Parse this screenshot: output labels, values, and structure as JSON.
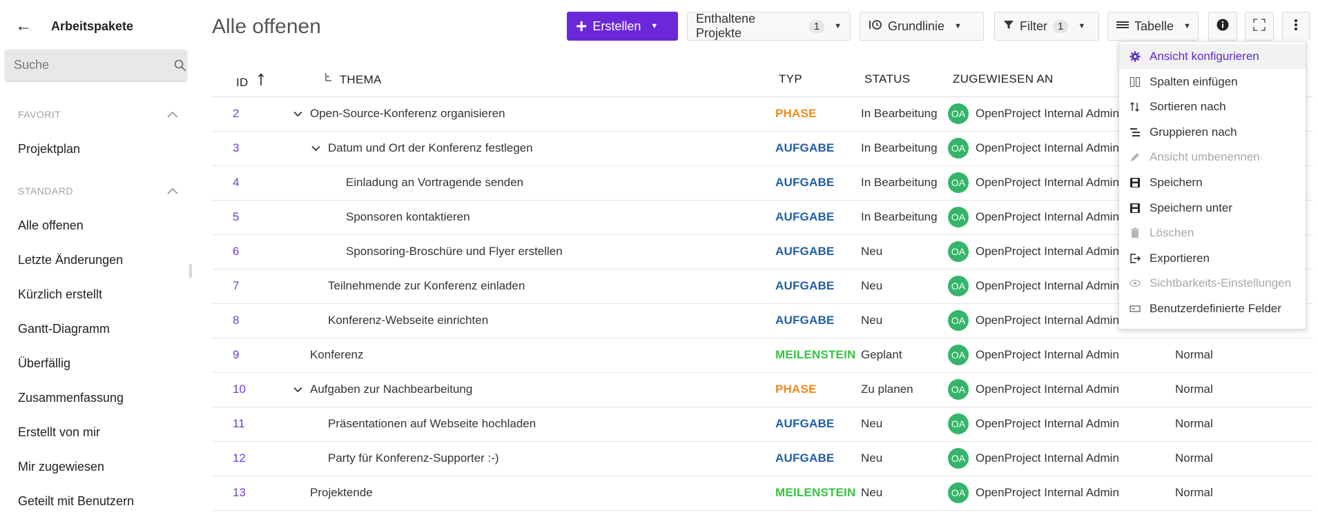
{
  "sidebar": {
    "back_icon": "arrow-left-icon",
    "title": "Arbeitspakete",
    "search_placeholder": "Suche",
    "sections": [
      {
        "label": "FAVORIT",
        "items": [
          "Projektplan"
        ]
      },
      {
        "label": "STANDARD",
        "items": [
          "Alle offenen",
          "Letzte Änderungen",
          "Kürzlich erstellt",
          "Gantt-Diagramm",
          "Überfällig",
          "Zusammenfassung",
          "Erstellt von mir",
          "Mir zugewiesen",
          "Geteilt mit Benutzern"
        ]
      }
    ]
  },
  "toolbar": {
    "page_title": "Alle offenen",
    "create_label": "Erstellen",
    "included_projects_label": "Enthaltene Projekte",
    "included_projects_count": "1",
    "baseline_label": "Grundlinie",
    "filter_label": "Filter",
    "filter_count": "1",
    "view_label": "Tabelle"
  },
  "table": {
    "columns": {
      "id": "ID",
      "subject": "THEMA",
      "type": "TYP",
      "status": "STATUS",
      "assignee": "ZUGEWIESEN AN"
    },
    "rows": [
      {
        "id": "2",
        "subject": "Open-Source-Konferenz organisieren",
        "level": 0,
        "expand": true,
        "type": "PHASE",
        "status": "In Bearbeitung",
        "initials": "OA",
        "assignee": "OpenProject Internal Admin",
        "priority": ""
      },
      {
        "id": "3",
        "subject": "Datum und Ort der Konferenz festlegen",
        "level": 1,
        "expand": true,
        "type": "AUFGABE",
        "status": "In Bearbeitung",
        "initials": "OA",
        "assignee": "OpenProject Internal Admin",
        "priority": ""
      },
      {
        "id": "4",
        "subject": "Einladung an Vortragende senden",
        "level": 2,
        "expand": false,
        "type": "AUFGABE",
        "status": "In Bearbeitung",
        "initials": "OA",
        "assignee": "OpenProject Internal Admin",
        "priority": ""
      },
      {
        "id": "5",
        "subject": "Sponsoren kontaktieren",
        "level": 2,
        "expand": false,
        "type": "AUFGABE",
        "status": "In Bearbeitung",
        "initials": "OA",
        "assignee": "OpenProject Internal Admin",
        "priority": ""
      },
      {
        "id": "6",
        "subject": "Sponsoring-Broschüre und Flyer erstellen",
        "level": 2,
        "expand": false,
        "type": "AUFGABE",
        "status": "Neu",
        "initials": "OA",
        "assignee": "OpenProject Internal Admin",
        "priority": ""
      },
      {
        "id": "7",
        "subject": "Teilnehmende zur Konferenz einladen",
        "level": 1,
        "expand": false,
        "type": "AUFGABE",
        "status": "Neu",
        "initials": "OA",
        "assignee": "OpenProject Internal Admin",
        "priority": ""
      },
      {
        "id": "8",
        "subject": "Konferenz-Webseite einrichten",
        "level": 1,
        "expand": false,
        "type": "AUFGABE",
        "status": "Neu",
        "initials": "OA",
        "assignee": "OpenProject Internal Admin",
        "priority": ""
      },
      {
        "id": "9",
        "subject": "Konferenz",
        "level": 0,
        "expand": false,
        "type": "MEILENSTEIN",
        "status": "Geplant",
        "initials": "OA",
        "assignee": "OpenProject Internal Admin",
        "priority": "Normal"
      },
      {
        "id": "10",
        "subject": "Aufgaben zur Nachbearbeitung",
        "level": 0,
        "expand": true,
        "type": "PHASE",
        "status": "Zu planen",
        "initials": "OA",
        "assignee": "OpenProject Internal Admin",
        "priority": "Normal"
      },
      {
        "id": "11",
        "subject": "Präsentationen auf Webseite hochladen",
        "level": 1,
        "expand": false,
        "type": "AUFGABE",
        "status": "Neu",
        "initials": "OA",
        "assignee": "OpenProject Internal Admin",
        "priority": "Normal"
      },
      {
        "id": "12",
        "subject": "Party für Konferenz-Supporter :-)",
        "level": 1,
        "expand": false,
        "type": "AUFGABE",
        "status": "Neu",
        "initials": "OA",
        "assignee": "OpenProject Internal Admin",
        "priority": "Normal"
      },
      {
        "id": "13",
        "subject": "Projektende",
        "level": 0,
        "expand": false,
        "type": "MEILENSTEIN",
        "status": "Neu",
        "initials": "OA",
        "assignee": "OpenProject Internal Admin",
        "priority": "Normal"
      }
    ]
  },
  "type_colors": {
    "PHASE": "#f28a1c",
    "AUFGABE": "#1f5fa6",
    "MEILENSTEIN": "#35c53f"
  },
  "menu": {
    "items": [
      {
        "label": "Ansicht konfigurieren",
        "icon": "gear-icon",
        "state": "active"
      },
      {
        "label": "Spalten einfügen",
        "icon": "columns-icon",
        "state": "normal"
      },
      {
        "label": "Sortieren nach",
        "icon": "sort-icon",
        "state": "normal"
      },
      {
        "label": "Gruppieren nach",
        "icon": "group-icon",
        "state": "normal"
      },
      {
        "label": "Ansicht umbenennen",
        "icon": "pencil-icon",
        "state": "disabled"
      },
      {
        "label": "Speichern",
        "icon": "save-icon",
        "state": "normal"
      },
      {
        "label": "Speichern unter",
        "icon": "save-as-icon",
        "state": "normal"
      },
      {
        "label": "Löschen",
        "icon": "trash-icon",
        "state": "disabled"
      },
      {
        "label": "Exportieren",
        "icon": "export-icon",
        "state": "normal"
      },
      {
        "label": "Sichtbarkeits-Einstellungen",
        "icon": "eye-icon",
        "state": "disabled"
      },
      {
        "label": "Benutzerdefinierte Felder",
        "icon": "custom-fields-icon",
        "state": "normal"
      }
    ]
  }
}
